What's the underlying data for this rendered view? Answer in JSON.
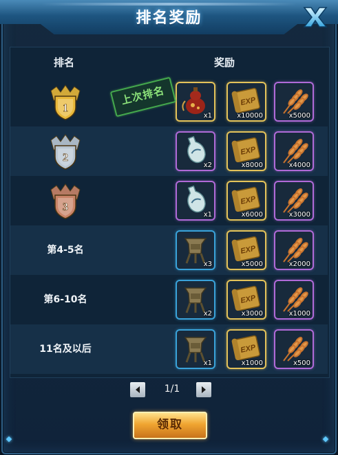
{
  "window": {
    "title": "排名奖励"
  },
  "columns": {
    "rank": "排名",
    "reward": "奖励"
  },
  "stamp": "上次排名",
  "rows": [
    {
      "rank_label": "",
      "medal": "gold-medal-icon",
      "medal_num": "1",
      "rewards": [
        {
          "icon": "gourd-icon",
          "qty": "x1",
          "border": "yellow"
        },
        {
          "icon": "exp-scroll-icon",
          "qty": "x10000",
          "border": "yellow"
        },
        {
          "icon": "wheat-icon",
          "qty": "x5000",
          "border": "purple"
        }
      ]
    },
    {
      "rank_label": "",
      "medal": "silver-medal-icon",
      "medal_num": "2",
      "rewards": [
        {
          "icon": "vase-icon",
          "qty": "x2",
          "border": "purple"
        },
        {
          "icon": "exp-scroll-icon",
          "qty": "x8000",
          "border": "yellow"
        },
        {
          "icon": "wheat-icon",
          "qty": "x4000",
          "border": "purple"
        }
      ]
    },
    {
      "rank_label": "",
      "medal": "bronze-medal-icon",
      "medal_num": "3",
      "rewards": [
        {
          "icon": "vase-icon",
          "qty": "x1",
          "border": "purple"
        },
        {
          "icon": "exp-scroll-icon",
          "qty": "x6000",
          "border": "yellow"
        },
        {
          "icon": "wheat-icon",
          "qty": "x3000",
          "border": "purple"
        }
      ]
    },
    {
      "rank_label": "第4-5名",
      "rewards": [
        {
          "icon": "bronze-vessel-icon",
          "qty": "x3",
          "border": "blue"
        },
        {
          "icon": "exp-scroll-icon",
          "qty": "x5000",
          "border": "yellow"
        },
        {
          "icon": "wheat-icon",
          "qty": "x2000",
          "border": "purple"
        }
      ]
    },
    {
      "rank_label": "第6-10名",
      "rewards": [
        {
          "icon": "bronze-vessel-icon",
          "qty": "x2",
          "border": "blue"
        },
        {
          "icon": "exp-scroll-icon",
          "qty": "x3000",
          "border": "yellow"
        },
        {
          "icon": "wheat-icon",
          "qty": "x1000",
          "border": "purple"
        }
      ]
    },
    {
      "rank_label": "11名及以后",
      "rewards": [
        {
          "icon": "bronze-vessel-icon",
          "qty": "x1",
          "border": "blue"
        },
        {
          "icon": "exp-scroll-icon",
          "qty": "x1000",
          "border": "yellow"
        },
        {
          "icon": "wheat-icon",
          "qty": "x500",
          "border": "purple"
        }
      ]
    }
  ],
  "exp_text": "EXP",
  "pager": {
    "page": "1/1"
  },
  "buttons": {
    "claim": "领取"
  },
  "colors": {
    "gold": "#e8b83a",
    "silver": "#b9c6d2",
    "bronze": "#c98468"
  }
}
